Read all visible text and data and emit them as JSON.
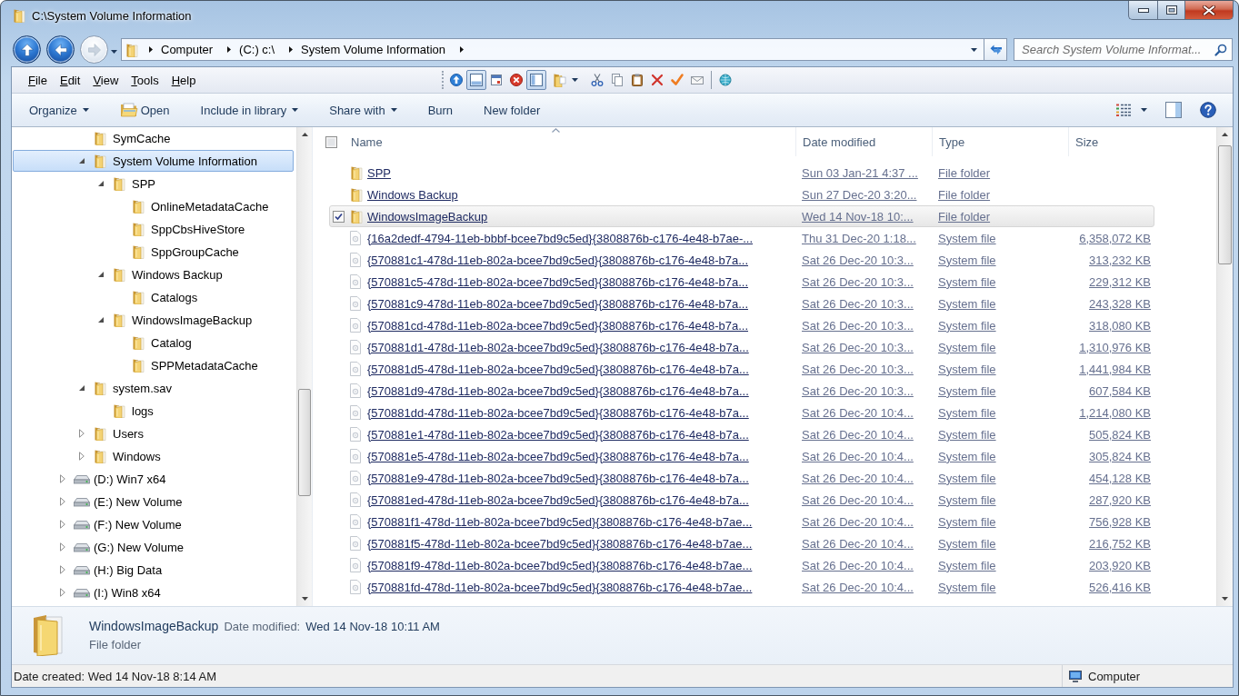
{
  "window": {
    "title": "C:\\System Volume Information"
  },
  "nav_buttons": [
    {
      "kind": "up",
      "disabled": false
    },
    {
      "kind": "back",
      "disabled": false
    },
    {
      "kind": "forward",
      "disabled": true
    }
  ],
  "address_bar": {
    "breadcrumbs": [
      "Computer",
      "(C:) c:\\",
      "System Volume Information"
    ]
  },
  "search": {
    "placeholder": "Search System Volume Informat..."
  },
  "menu_bar": [
    "File",
    "Edit",
    "View",
    "Tools",
    "Help"
  ],
  "toolbar": [
    {
      "kind": "up",
      "pressed": false
    },
    {
      "kind": "preview_pane",
      "pressed": true
    },
    {
      "kind": "calendar",
      "pressed": false
    },
    {
      "kind": "stop",
      "pressed": false
    },
    {
      "kind": "navigation_pane",
      "pressed": true
    },
    {
      "kind": "folder_menu",
      "pressed": false
    },
    {
      "kind": "cut",
      "pressed": false
    },
    {
      "kind": "copy",
      "pressed": false
    },
    {
      "kind": "paste",
      "pressed": false
    },
    {
      "kind": "delete",
      "pressed": false
    },
    {
      "kind": "check",
      "pressed": false
    },
    {
      "kind": "mail",
      "pressed": false
    },
    {
      "kind": "separator"
    },
    {
      "kind": "globe",
      "pressed": false
    }
  ],
  "command_bar": {
    "items": [
      {
        "label": "Organize",
        "kind": "menu"
      },
      {
        "label": "Open",
        "kind": "icon"
      },
      {
        "label": "Include in library",
        "kind": "menu"
      },
      {
        "label": "Share with",
        "kind": "menu"
      },
      {
        "label": "Burn",
        "kind": "plain"
      },
      {
        "label": "New folder",
        "kind": "plain"
      }
    ]
  },
  "navigation_tree": {
    "items": [
      {
        "label": "SymCache",
        "kind": "leaf",
        "expanded": false,
        "selected": false
      },
      {
        "label": "System Volume Information",
        "kind": "branch",
        "expanded": true,
        "selected": true,
        "children": [
          {
            "label": "SPP",
            "kind": "branch",
            "expanded": true,
            "selected": false,
            "children": [
              {
                "label": "OnlineMetadataCache",
                "kind": "leaf",
                "expanded": false,
                "selected": false
              },
              {
                "label": "SppCbsHiveStore",
                "kind": "leaf",
                "expanded": false,
                "selected": false
              },
              {
                "label": "SppGroupCache",
                "kind": "leaf",
                "expanded": false,
                "selected": false
              }
            ]
          },
          {
            "label": "Windows Backup",
            "kind": "branch",
            "expanded": true,
            "selected": false,
            "children": [
              {
                "label": "Catalogs",
                "kind": "leaf",
                "expanded": false,
                "selected": false
              }
            ]
          },
          {
            "label": "WindowsImageBackup",
            "kind": "branch",
            "expanded": true,
            "selected": false,
            "children": [
              {
                "label": "Catalog",
                "kind": "leaf",
                "expanded": false,
                "selected": false
              },
              {
                "label": "SPPMetadataCache",
                "kind": "leaf",
                "expanded": false,
                "selected": false
              }
            ]
          }
        ]
      },
      {
        "label": "system.sav",
        "kind": "branch",
        "expanded": true,
        "selected": false,
        "children": [
          {
            "label": "logs",
            "kind": "leaf",
            "expanded": false,
            "selected": false
          }
        ]
      },
      {
        "label": "Users",
        "kind": "branch",
        "expanded": false,
        "selected": false
      },
      {
        "label": "Windows",
        "kind": "branch",
        "expanded": false,
        "selected": false
      }
    ],
    "drives": [
      {
        "label": "(D:) Win7 x64",
        "kind": "branch",
        "expanded": false,
        "selected": false
      },
      {
        "label": "(E:) New Volume",
        "kind": "branch",
        "expanded": false,
        "selected": false
      },
      {
        "label": "(F:) New Volume",
        "kind": "branch",
        "expanded": false,
        "selected": false
      },
      {
        "label": "(G:) New Volume",
        "kind": "branch",
        "expanded": false,
        "selected": false
      },
      {
        "label": "(H:) Big Data",
        "kind": "branch",
        "expanded": false,
        "selected": false
      },
      {
        "label": "(I:) Win8 x64",
        "kind": "branch",
        "expanded": false,
        "selected": false
      }
    ]
  },
  "file_list": {
    "select_all_checked": false,
    "columns": [
      {
        "label": "Name",
        "sorted": true
      },
      {
        "label": "Date modified",
        "sorted": false
      },
      {
        "label": "Type",
        "sorted": false
      },
      {
        "label": "Size",
        "sorted": false
      }
    ],
    "rows": [
      {
        "kind": "folder",
        "name": "SPP",
        "date_modified": "Sun 03 Jan-21 4:37 ...",
        "type": "File folder",
        "selected": false
      },
      {
        "kind": "folder",
        "name": "Windows Backup",
        "date_modified": "Sun 27 Dec-20 3:20...",
        "type": "File folder",
        "selected": false
      },
      {
        "kind": "folder",
        "name": "WindowsImageBackup",
        "date_modified": "Wed 14 Nov-18 10:...",
        "type": "File folder",
        "selected": true
      },
      {
        "kind": "file",
        "name": "{16a2dedf-4794-11eb-bbbf-bcee7bd9c5ed}{3808876b-c176-4e48-b7ae-...",
        "date_modified": "Thu 31 Dec-20 1:18...",
        "type": "System file",
        "size": "6,358,072 KB",
        "selected": false
      },
      {
        "kind": "file",
        "name": "{570881c1-478d-11eb-802a-bcee7bd9c5ed}{3808876b-c176-4e48-b7a...",
        "date_modified": "Sat 26 Dec-20 10:3...",
        "type": "System file",
        "size": "313,232 KB",
        "selected": false
      },
      {
        "kind": "file",
        "name": "{570881c5-478d-11eb-802a-bcee7bd9c5ed}{3808876b-c176-4e48-b7a...",
        "date_modified": "Sat 26 Dec-20 10:3...",
        "type": "System file",
        "size": "229,312 KB",
        "selected": false
      },
      {
        "kind": "file",
        "name": "{570881c9-478d-11eb-802a-bcee7bd9c5ed}{3808876b-c176-4e48-b7a...",
        "date_modified": "Sat 26 Dec-20 10:3...",
        "type": "System file",
        "size": "243,328 KB",
        "selected": false
      },
      {
        "kind": "file",
        "name": "{570881cd-478d-11eb-802a-bcee7bd9c5ed}{3808876b-c176-4e48-b7a...",
        "date_modified": "Sat 26 Dec-20 10:3...",
        "type": "System file",
        "size": "318,080 KB",
        "selected": false
      },
      {
        "kind": "file",
        "name": "{570881d1-478d-11eb-802a-bcee7bd9c5ed}{3808876b-c176-4e48-b7a...",
        "date_modified": "Sat 26 Dec-20 10:3...",
        "type": "System file",
        "size": "1,310,976 KB",
        "selected": false
      },
      {
        "kind": "file",
        "name": "{570881d5-478d-11eb-802a-bcee7bd9c5ed}{3808876b-c176-4e48-b7a...",
        "date_modified": "Sat 26 Dec-20 10:3...",
        "type": "System file",
        "size": "1,441,984 KB",
        "selected": false
      },
      {
        "kind": "file",
        "name": "{570881d9-478d-11eb-802a-bcee7bd9c5ed}{3808876b-c176-4e48-b7a...",
        "date_modified": "Sat 26 Dec-20 10:3...",
        "type": "System file",
        "size": "607,584 KB",
        "selected": false
      },
      {
        "kind": "file",
        "name": "{570881dd-478d-11eb-802a-bcee7bd9c5ed}{3808876b-c176-4e48-b7a...",
        "date_modified": "Sat 26 Dec-20 10:4...",
        "type": "System file",
        "size": "1,214,080 KB",
        "selected": false
      },
      {
        "kind": "file",
        "name": "{570881e1-478d-11eb-802a-bcee7bd9c5ed}{3808876b-c176-4e48-b7a...",
        "date_modified": "Sat 26 Dec-20 10:4...",
        "type": "System file",
        "size": "505,824 KB",
        "selected": false
      },
      {
        "kind": "file",
        "name": "{570881e5-478d-11eb-802a-bcee7bd9c5ed}{3808876b-c176-4e48-b7a...",
        "date_modified": "Sat 26 Dec-20 10:4...",
        "type": "System file",
        "size": "305,824 KB",
        "selected": false
      },
      {
        "kind": "file",
        "name": "{570881e9-478d-11eb-802a-bcee7bd9c5ed}{3808876b-c176-4e48-b7a...",
        "date_modified": "Sat 26 Dec-20 10:4...",
        "type": "System file",
        "size": "454,128 KB",
        "selected": false
      },
      {
        "kind": "file",
        "name": "{570881ed-478d-11eb-802a-bcee7bd9c5ed}{3808876b-c176-4e48-b7a...",
        "date_modified": "Sat 26 Dec-20 10:4...",
        "type": "System file",
        "size": "287,920 KB",
        "selected": false
      },
      {
        "kind": "file",
        "name": "{570881f1-478d-11eb-802a-bcee7bd9c5ed}{3808876b-c176-4e48-b7ae...",
        "date_modified": "Sat 26 Dec-20 10:4...",
        "type": "System file",
        "size": "756,928 KB",
        "selected": false
      },
      {
        "kind": "file",
        "name": "{570881f5-478d-11eb-802a-bcee7bd9c5ed}{3808876b-c176-4e48-b7ae...",
        "date_modified": "Sat 26 Dec-20 10:4...",
        "type": "System file",
        "size": "216,752 KB",
        "selected": false
      },
      {
        "kind": "file",
        "name": "{570881f9-478d-11eb-802a-bcee7bd9c5ed}{3808876b-c176-4e48-b7ae...",
        "date_modified": "Sat 26 Dec-20 10:4...",
        "type": "System file",
        "size": "203,920 KB",
        "selected": false
      },
      {
        "kind": "file",
        "name": "{570881fd-478d-11eb-802a-bcee7bd9c5ed}{3808876b-c176-4e48-b7ae...",
        "date_modified": "Sat 26 Dec-20 10:4...",
        "type": "System file",
        "size": "526,416 KB",
        "selected": false
      }
    ]
  },
  "details_pane": {
    "name": "WindowsImageBackup",
    "date_label": "Date modified:",
    "date_value": "Wed 14 Nov-18 10:11 AM",
    "type": "File folder"
  },
  "status_bar": {
    "text": "Date created: Wed 14 Nov-18 8:14 AM",
    "location": "Computer"
  }
}
